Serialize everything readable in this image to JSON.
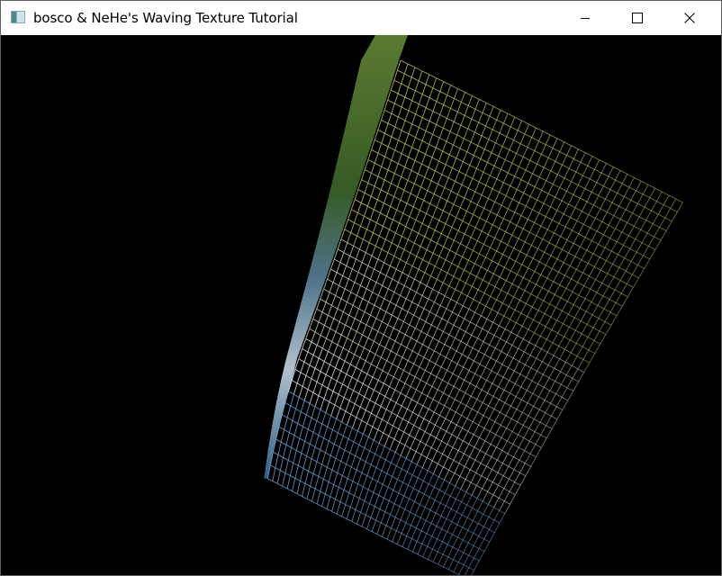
{
  "window": {
    "title": "bosco & NeHe's Waving Texture Tutorial",
    "controls": {
      "minimize_icon": "minimize-icon",
      "maximize_icon": "maximize-icon",
      "close_icon": "close-icon"
    }
  },
  "scene": {
    "background": "#000000",
    "mesh_colors": {
      "green": "#b8c05a",
      "white": "#e8eef2",
      "blue": "#6d9cc7",
      "texture_green": "#4f7a2c"
    }
  }
}
